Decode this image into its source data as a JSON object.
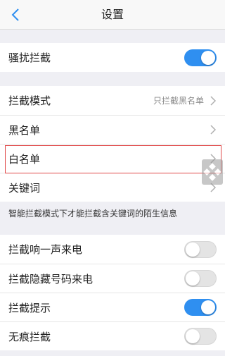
{
  "header": {
    "title": "设置",
    "back_icon": "chevron-left-icon"
  },
  "colors": {
    "accent": "#2f8ff0",
    "highlight": "#e04848"
  },
  "harass_group": [
    {
      "label": "骚扰拦截",
      "toggle": true
    }
  ],
  "mode_group": [
    {
      "label": "拦截模式",
      "value": "只拦截黑名单"
    },
    {
      "label": "黑名单"
    },
    {
      "label": "白名单"
    },
    {
      "label": "关键词"
    }
  ],
  "keyword_note": "智能拦截模式下才能拦截含关键词的陌生信息",
  "options_group": [
    {
      "label": "拦截响一声来电",
      "toggle": false
    },
    {
      "label": "拦截隐藏号码来电",
      "toggle": false
    },
    {
      "label": "拦截提示",
      "toggle": true
    },
    {
      "label": "无痕拦截",
      "toggle": false
    }
  ]
}
